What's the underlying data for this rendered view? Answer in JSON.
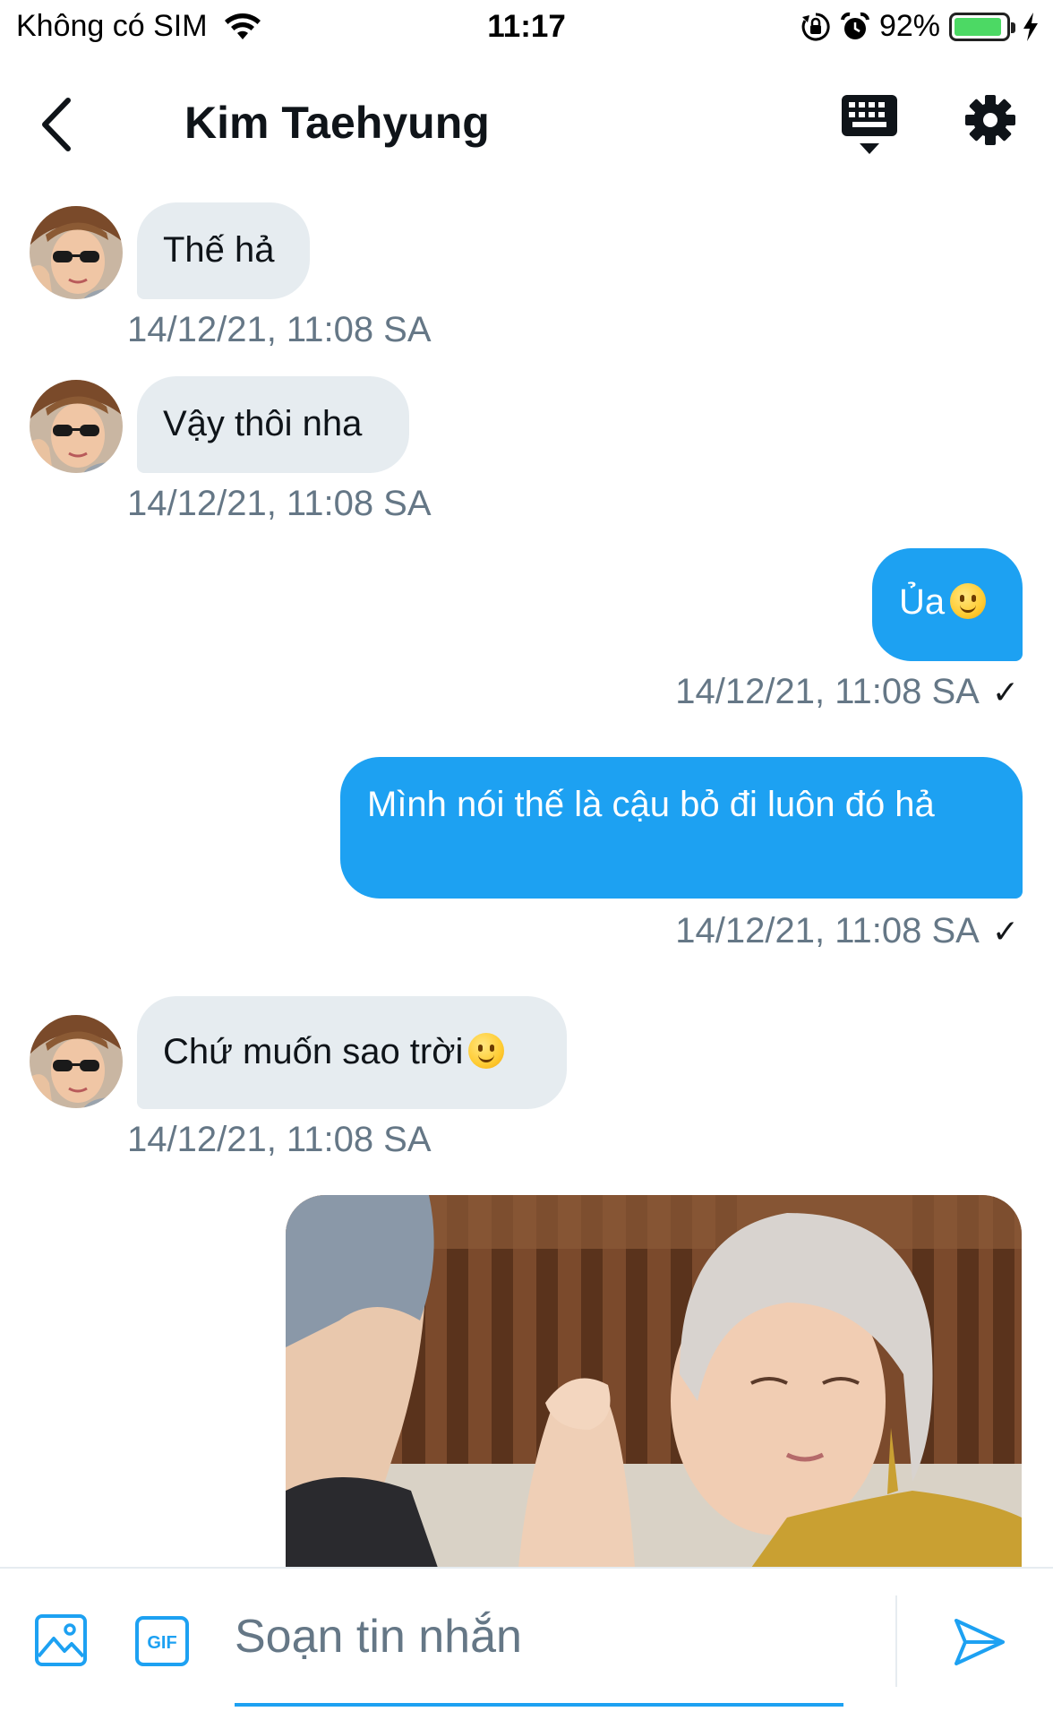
{
  "status_bar": {
    "carrier": "Không có SIM",
    "time": "11:17",
    "battery": "92%",
    "battery_level": 0.92
  },
  "header": {
    "title": "Kim Taehyung"
  },
  "messages": [
    {
      "direction": "in",
      "text": "Thế hả",
      "timestamp": "14/12/21, 11:08 SA"
    },
    {
      "direction": "in",
      "text": "Vậy thôi nha",
      "timestamp": "14/12/21, 11:08 SA"
    },
    {
      "direction": "out",
      "text": "Ủa",
      "emoji": "slightly-smiling-face",
      "timestamp": "14/12/21, 11:08 SA",
      "status": "✓"
    },
    {
      "direction": "out",
      "text": "Mình nói thế là cậu bỏ đi luôn đó hả",
      "timestamp": "14/12/21, 11:08 SA",
      "status": "✓"
    },
    {
      "direction": "in",
      "text": "Chứ muốn sao trời",
      "emoji": "slightly-smiling-face",
      "timestamp": "14/12/21, 11:08 SA"
    },
    {
      "direction": "out",
      "type": "image"
    }
  ],
  "composer": {
    "placeholder": "Soạn tin nhắn",
    "gif_label": "GIF"
  },
  "colors": {
    "accent": "#1da1f2",
    "incoming_bubble": "#e6ecf0",
    "timestamp": "#657786",
    "battery": "#4cd964"
  },
  "icons": [
    "wifi-icon",
    "orientation-lock-icon",
    "alarm-icon",
    "charging-icon",
    "back-chevron-icon",
    "keyboard-icon",
    "gear-icon",
    "image-icon",
    "gif-icon",
    "send-icon"
  ]
}
